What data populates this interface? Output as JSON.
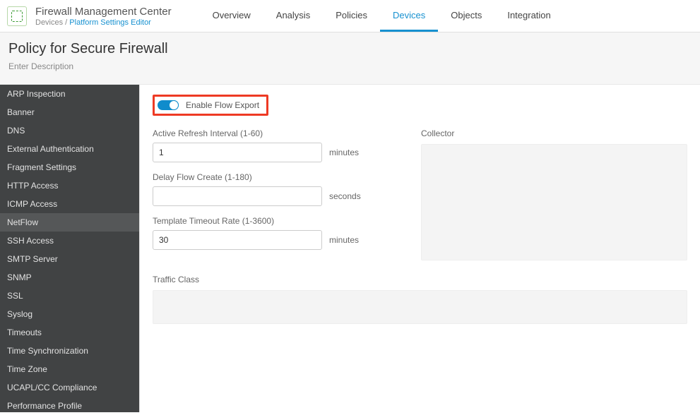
{
  "header": {
    "app_title": "Firewall Management Center",
    "breadcrumb_static": "Devices / ",
    "breadcrumb_link": "Platform Settings Editor",
    "tabs": [
      {
        "label": "Overview"
      },
      {
        "label": "Analysis"
      },
      {
        "label": "Policies"
      },
      {
        "label": "Devices",
        "active": true
      },
      {
        "label": "Objects"
      },
      {
        "label": "Integration"
      }
    ]
  },
  "subheader": {
    "title": "Policy for Secure Firewall",
    "description": "Enter Description"
  },
  "sidebar": {
    "items": [
      {
        "label": "ARP Inspection"
      },
      {
        "label": "Banner"
      },
      {
        "label": "DNS"
      },
      {
        "label": "External Authentication"
      },
      {
        "label": "Fragment Settings"
      },
      {
        "label": "HTTP Access"
      },
      {
        "label": "ICMP Access"
      },
      {
        "label": "NetFlow",
        "selected": true
      },
      {
        "label": "SSH Access"
      },
      {
        "label": "SMTP Server"
      },
      {
        "label": "SNMP"
      },
      {
        "label": "SSL"
      },
      {
        "label": "Syslog"
      },
      {
        "label": "Timeouts"
      },
      {
        "label": "Time Synchronization"
      },
      {
        "label": "Time Zone"
      },
      {
        "label": "UCAPL/CC Compliance"
      },
      {
        "label": "Performance Profile"
      }
    ]
  },
  "content": {
    "toggle_label": "Enable Flow Export",
    "toggle_on": true,
    "active_refresh_label": "Active Refresh Interval (1-60)",
    "active_refresh_value": "1",
    "active_refresh_unit": "minutes",
    "delay_flow_label": "Delay Flow Create (1-180)",
    "delay_flow_value": "",
    "delay_flow_unit": "seconds",
    "template_timeout_label": "Template Timeout Rate (1-3600)",
    "template_timeout_value": "30",
    "template_timeout_unit": "minutes",
    "collector_label": "Collector",
    "traffic_class_label": "Traffic Class"
  }
}
